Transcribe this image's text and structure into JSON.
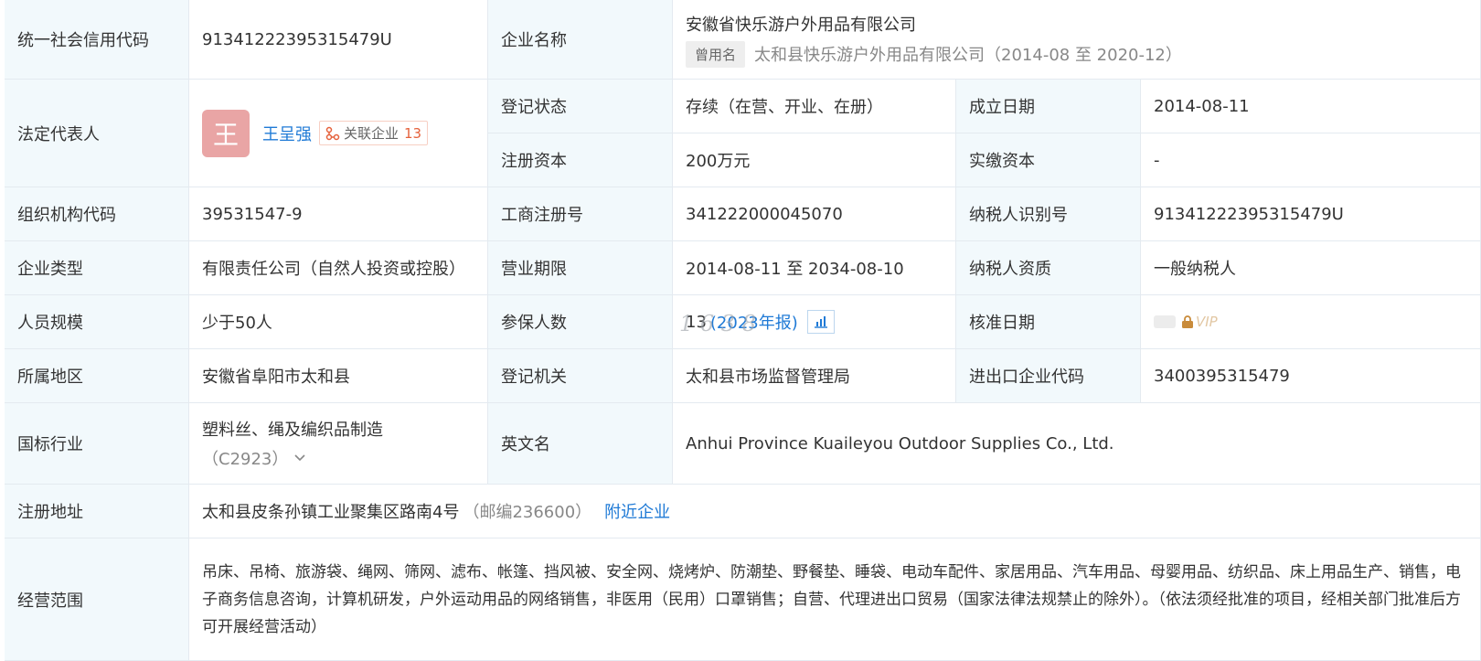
{
  "labels": {
    "credit_code": "统一社会信用代码",
    "company_name": "企业名称",
    "legal_rep": "法定代表人",
    "reg_status": "登记状态",
    "found_date": "成立日期",
    "reg_capital": "注册资本",
    "paid_capital": "实缴资本",
    "org_code": "组织机构代码",
    "biz_reg_no": "工商注册号",
    "taxpayer_id": "纳税人识别号",
    "company_type": "企业类型",
    "biz_term": "营业期限",
    "taxpayer_qual": "纳税人资质",
    "staff_size": "人员规模",
    "insured_count": "参保人数",
    "approval_date": "核准日期",
    "region": "所属地区",
    "reg_authority": "登记机关",
    "import_export_code": "进出口企业代码",
    "industry": "国标行业",
    "english_name": "英文名",
    "reg_address": "注册地址",
    "biz_scope": "经营范围"
  },
  "values": {
    "credit_code": "91341222395315479U",
    "company_name": "安徽省快乐游户外用品有限公司",
    "former_name_tag": "曾用名",
    "former_name": "太和县快乐游户外用品有限公司",
    "former_name_period": "（2014-08 至 2020-12）",
    "legal_rep_avatar": "王",
    "legal_rep_name": "王呈强",
    "assoc_label": "关联企业",
    "assoc_count": "13",
    "reg_status": "存续（在营、开业、在册）",
    "found_date": "2014-08-11",
    "reg_capital": "200万元",
    "paid_capital": "-",
    "org_code": "39531547-9",
    "biz_reg_no": "341222000045070",
    "taxpayer_id": "91341222395315479U",
    "company_type": "有限责任公司（自然人投资或控股）",
    "biz_term": "2014-08-11 至 2034-08-10",
    "taxpayer_qual": "一般纳税人",
    "staff_size": "少于50人",
    "insured_count": "13",
    "insured_report": "(2023年报)",
    "approval_vip": "VIP",
    "region": "安徽省阜阳市太和县",
    "reg_authority": "太和县市场监督管理局",
    "import_export_code": "3400395315479",
    "industry_name": "塑料丝、绳及编织品制造",
    "industry_code": "（C2923）",
    "english_name": "Anhui Province Kuaileyou Outdoor Supplies Co., Ltd.",
    "reg_address": "太和县皮条孙镇工业聚集区路南4号",
    "postcode": "（邮编236600）",
    "nearby_link": "附近企业",
    "biz_scope": "吊床、吊椅、旅游袋、绳网、筛网、滤布、帐篷、挡风被、安全网、烧烤炉、防潮垫、野餐垫、睡袋、电动车配件、家居用品、汽车用品、母婴用品、纺织品、床上用品生产、销售，电子商务信息咨询，计算机研发，户外运动用品的网络销售，非医用（民用）口罩销售；自营、代理进出口贸易（国家法律法规禁止的除外）。（依法须经批准的项目，经相关部门批准后方可开展经营活动）"
  },
  "watermark": "1 6 3 8",
  "colors": {
    "label_bg": "#f2f9fc",
    "link": "#1f7ad6",
    "border": "#e4eaf0",
    "assoc_count": "#e5613b",
    "avatar_bg": "#e9a5a5"
  }
}
